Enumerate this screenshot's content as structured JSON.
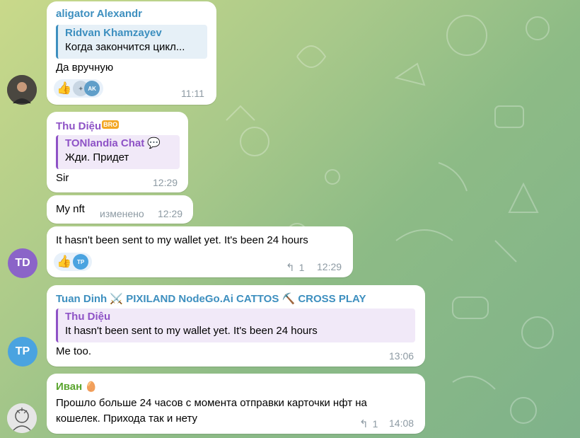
{
  "messages": [
    {
      "sender": "aligator Alexandr",
      "reply_name": "Ridvan Khamzayev",
      "reply_text": "Когда закончится цикл...",
      "text": "Да вручную",
      "time": "11:11",
      "reaction_avatar": "AK"
    },
    {
      "sender": "Thu Diệu",
      "sender_badge": "BRO",
      "reply_name": "TONlandia Chat 💬",
      "reply_text": "Жди. Придет",
      "text": "Sir",
      "time": "12:29"
    },
    {
      "text": "My nft",
      "edited": "изменено",
      "time": "12:29"
    },
    {
      "text": "It hasn't been sent to my wallet yet. It's been 24 hours",
      "replies": "1",
      "time": "12:29",
      "reaction_avatar": "TP",
      "avatar": "TD"
    },
    {
      "sender": "Tuan Dinh ⚔️ PIXILAND NodeGo.Ai CATTOS ⛏️ CROSS PLAY",
      "reply_name": "Thu Diệu",
      "reply_text": "It hasn't been sent to my wallet yet. It's been 24 hours",
      "text": "Me too.",
      "time": "13:06",
      "avatar": "TP"
    },
    {
      "sender": "Иван",
      "text_line1": "Прошло больше 24 часов с момента отправки карточки нфт на",
      "text_line2": "кошелек. Прихода так и нету",
      "replies": "1",
      "time": "14:08"
    }
  ],
  "colors": {
    "alexandr": "#3d8fbf",
    "thu": "#8e52c6",
    "tuan": "#3d8fbf",
    "ivan": "#5aa52e",
    "td_avatar": "#8b64c8",
    "tp_avatar": "#4aa3e0"
  }
}
